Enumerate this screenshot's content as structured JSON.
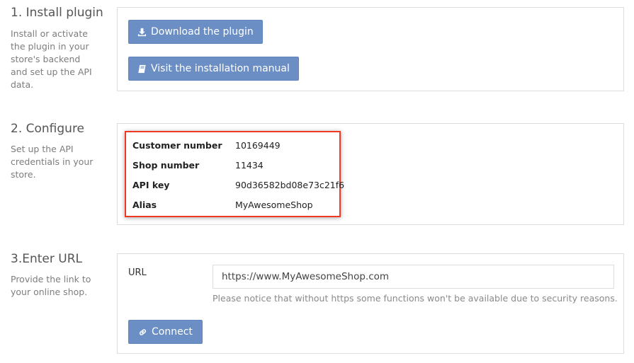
{
  "steps": {
    "install": {
      "title": "1. Install plugin",
      "description": "Install or activate the plugin in your store's backend and set up the API data.",
      "download_button": "Download the plugin",
      "download_icon": "download-icon",
      "manual_button": "Visit the installation manual",
      "manual_icon": "book-icon"
    },
    "configure": {
      "title": "2. Configure",
      "description": "Set up the API credentials in your store.",
      "credentials": [
        {
          "label": "Customer number",
          "value": "10169449"
        },
        {
          "label": "Shop number",
          "value": "11434"
        },
        {
          "label": "API key",
          "value": "90d36582bd08e73c21f6"
        },
        {
          "label": "Alias",
          "value": "MyAwesomeShop"
        }
      ],
      "highlight_color": "#ee3a24"
    },
    "url": {
      "title": "3.Enter URL",
      "description": "Provide the link to your online shop.",
      "field_label": "URL",
      "field_value": "https://www.MyAwesomeShop.com",
      "notice": "Please notice that without https some functions won't be available due to security reasons.",
      "connect_button": "Connect",
      "connect_icon": "link-icon"
    }
  },
  "colors": {
    "button": "#6b8fc4",
    "panel_border": "#dddddd"
  }
}
